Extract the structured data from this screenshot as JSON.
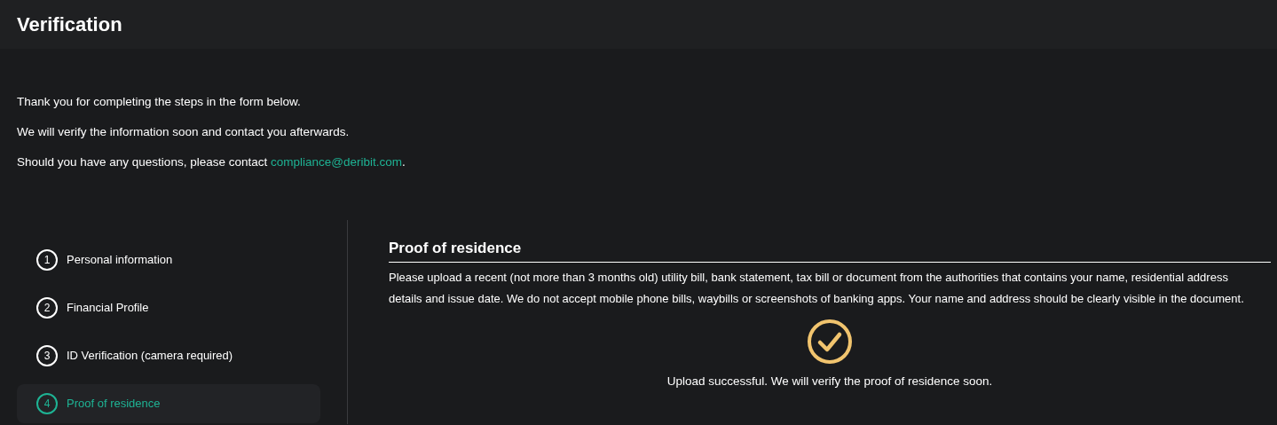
{
  "header": {
    "title": "Verification"
  },
  "intro": [
    {
      "text": "Thank you for completing the steps in the form below."
    },
    {
      "text": "We will verify the information soon and contact you afterwards."
    },
    {
      "text": "Should you have any questions, please contact ",
      "link": "compliance@deribit.com",
      "text_after": "."
    }
  ],
  "steps": [
    {
      "number": "1",
      "label": "Personal information",
      "selected": false
    },
    {
      "number": "2",
      "label": "Financial Profile",
      "selected": false
    },
    {
      "number": "3",
      "label": "ID Verification (camera required)",
      "selected": false
    },
    {
      "number": "4",
      "label": "Proof of residence",
      "selected": true
    }
  ],
  "section": {
    "title": "Proof of residence",
    "description": "Please upload a recent (not more than 3 months old) utility bill, bank statement, tax bill or document from the authorities that contains your name, residential address details and issue date. We do not accept mobile phone bills, waybills or screenshots of banking apps. Your name and address should be clearly visible in the document.",
    "uploaded": true,
    "message": "Upload successful. We will verify the proof of residence soon."
  }
}
